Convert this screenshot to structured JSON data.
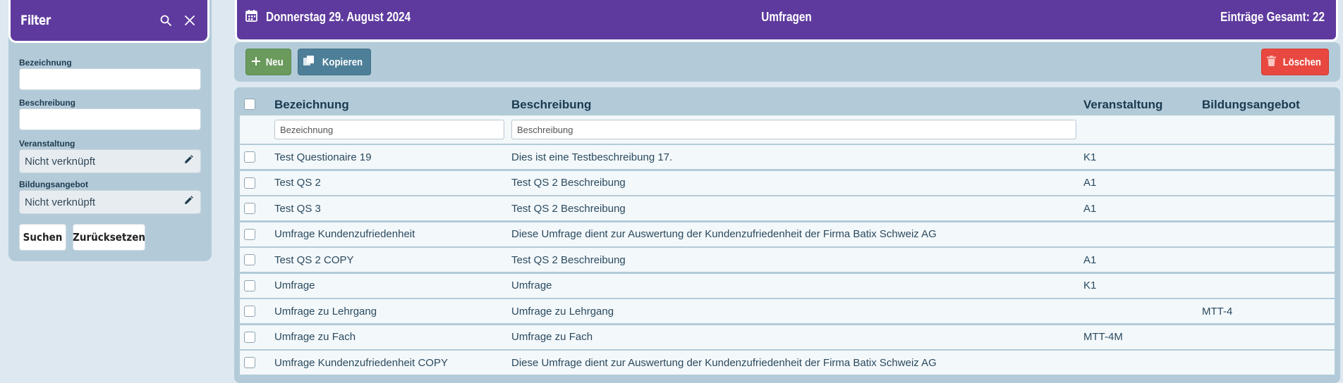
{
  "filter": {
    "title": "Filter",
    "fields": {
      "bezeichnung_label": "Bezeichnung",
      "beschreibung_label": "Beschreibung",
      "veranstaltung_label": "Veranstaltung",
      "veranstaltung_value": "Nicht verknüpft",
      "bildungsangebot_label": "Bildungsangebot",
      "bildungsangebot_value": "Nicht verknüpft"
    },
    "search_button": "Suchen",
    "reset_button": "Zurücksetzen"
  },
  "header": {
    "date": "Donnerstag 29. August 2024",
    "title": "Umfragen",
    "total": "Einträge Gesamt: 22"
  },
  "toolbar": {
    "new_label": "Neu",
    "copy_label": "Kopieren",
    "delete_label": "Löschen",
    "colors": {
      "new": "#6a9a5c",
      "copy": "#4d7f98",
      "delete": "#e8483f"
    }
  },
  "table": {
    "columns": [
      "Bezeichnung",
      "Beschreibung",
      "Veranstaltung",
      "Bildungsangebot"
    ],
    "placeholders": {
      "bezeichnung": "Bezeichnung",
      "beschreibung": "Beschreibung"
    },
    "rows": [
      {
        "bezeichnung": "Test Questionaire 19",
        "beschreibung": "Dies ist eine Testbeschreibung 17.",
        "veranstaltung": "K1",
        "bildungsangebot": ""
      },
      {
        "bezeichnung": "Test QS 2",
        "beschreibung": "Test QS 2 Beschreibung",
        "veranstaltung": "A1",
        "bildungsangebot": ""
      },
      {
        "bezeichnung": "Test QS 3",
        "beschreibung": "Test QS 2 Beschreibung",
        "veranstaltung": "A1",
        "bildungsangebot": ""
      },
      {
        "bezeichnung": "Umfrage Kundenzufriedenheit",
        "beschreibung": "Diese Umfrage dient zur Auswertung der Kundenzufriedenheit der Firma Batix Schweiz AG",
        "veranstaltung": "",
        "bildungsangebot": ""
      },
      {
        "bezeichnung": "Test QS 2 COPY",
        "beschreibung": "Test QS 2 Beschreibung",
        "veranstaltung": "A1",
        "bildungsangebot": ""
      },
      {
        "bezeichnung": "Umfrage",
        "beschreibung": "Umfrage",
        "veranstaltung": "K1",
        "bildungsangebot": ""
      },
      {
        "bezeichnung": "Umfrage zu Lehrgang",
        "beschreibung": "Umfrage zu Lehrgang",
        "veranstaltung": "",
        "bildungsangebot": "MTT-4"
      },
      {
        "bezeichnung": "Umfrage zu Fach",
        "beschreibung": "Umfrage zu Fach",
        "veranstaltung": "MTT-4M",
        "bildungsangebot": ""
      },
      {
        "bezeichnung": "Umfrage Kundenzufriedenheit COPY",
        "beschreibung": "Diese Umfrage dient zur Auswertung der Kundenzufriedenheit der Firma Batix Schweiz AG",
        "veranstaltung": "",
        "bildungsangebot": ""
      }
    ]
  },
  "icons": {
    "search": "search-icon",
    "close": "close-icon",
    "pencil": "pencil-icon",
    "calendar": "calendar-icon",
    "plus": "plus-icon",
    "copy": "copy-icon",
    "trash": "trash-icon"
  }
}
